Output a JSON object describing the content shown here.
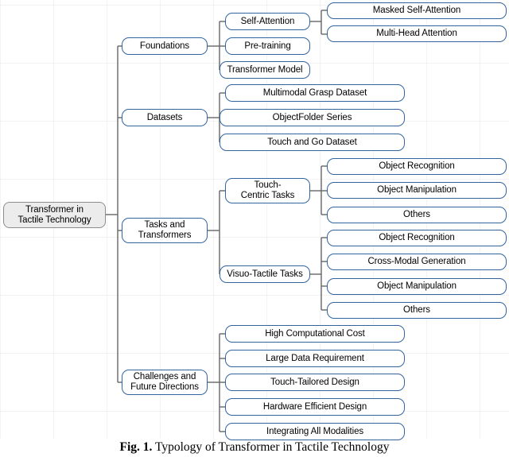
{
  "figure": {
    "caption_label": "Fig. 1.",
    "caption_text": " Typology of Transformer in Tactile Technology",
    "colors": {
      "node_border": "#3264a0",
      "node_fill": "#ffffff",
      "root_fill": "#ececec",
      "root_border": "#8c8c8c",
      "edge": "#666666",
      "text": "#000000"
    }
  },
  "tree": {
    "root": {
      "label": "Transformer in\nTactile Technology"
    },
    "branches": [
      {
        "label": "Foundations",
        "children": [
          {
            "label": "Self-Attention",
            "children": [
              {
                "label": "Masked Self-Attention"
              },
              {
                "label": "Multi-Head Attention"
              }
            ]
          },
          {
            "label": "Pre-training",
            "children": []
          },
          {
            "label": "Transformer Model",
            "children": []
          }
        ]
      },
      {
        "label": "Datasets",
        "children": [
          {
            "label": "Multimodal Grasp Dataset",
            "children": []
          },
          {
            "label": "ObjectFolder Series",
            "children": []
          },
          {
            "label": "Touch and Go Dataset",
            "children": []
          }
        ]
      },
      {
        "label": "Tasks and\nTransformers",
        "children": [
          {
            "label": "Touch-\nCentric Tasks",
            "children": [
              {
                "label": "Object Recognition"
              },
              {
                "label": "Object Manipulation"
              },
              {
                "label": "Others"
              }
            ]
          },
          {
            "label": "Visuo-Tactile Tasks",
            "children": [
              {
                "label": "Object Recognition"
              },
              {
                "label": "Cross-Modal Generation"
              },
              {
                "label": "Object Manipulation"
              },
              {
                "label": "Others"
              }
            ]
          }
        ]
      },
      {
        "label": "Challenges and\nFuture Directions",
        "children": [
          {
            "label": "High Computational Cost",
            "children": []
          },
          {
            "label": "Large Data Requirement",
            "children": []
          },
          {
            "label": "Touch-Tailored Design",
            "children": []
          },
          {
            "label": "Hardware Efficient Design",
            "children": []
          },
          {
            "label": "Integrating All Modalities",
            "children": []
          }
        ]
      }
    ]
  }
}
